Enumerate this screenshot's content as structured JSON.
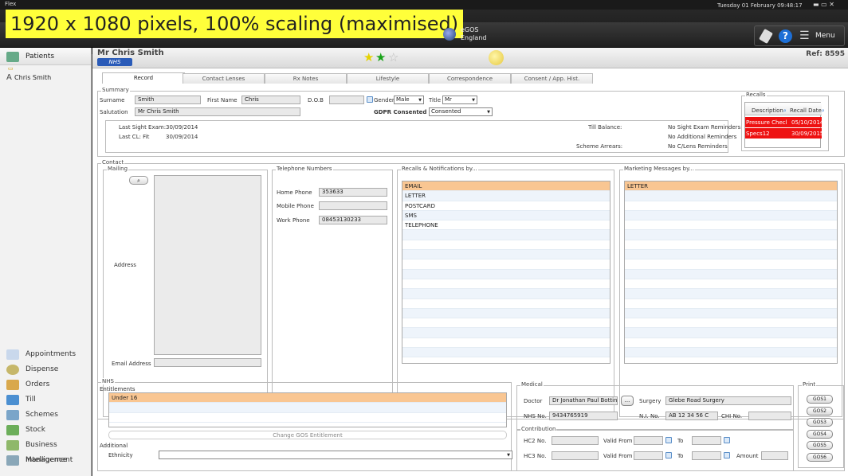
{
  "window": {
    "title": "Flex",
    "datetime": "Tuesday 01 February 09:48:17"
  },
  "banner": "1920 x 1080 pixels, 100% scaling (maximised)",
  "egos": {
    "line1": "eGOS",
    "line2": "England"
  },
  "toolbar": {
    "menu_label": "Menu"
  },
  "leftnav": {
    "header": "Patients",
    "patient": "Chris Smith",
    "items": [
      "Appointments",
      "Dispense",
      "Orders",
      "Till",
      "Schemes",
      "Stock",
      "Business Intelligence",
      "Management"
    ]
  },
  "patient": {
    "name": "Mr Chris Smith",
    "badge": "NHS",
    "ref": "Ref: 8595"
  },
  "tabs": [
    "Record",
    "Contact Lenses",
    "Rx Notes",
    "Lifestyle",
    "Correspondence",
    "Consent / App. Hist."
  ],
  "summary": {
    "legend": "Summary",
    "surname_label": "Surname",
    "surname": "Smith",
    "firstname_label": "First Name",
    "firstname": "Chris",
    "dob_label": "D.O.B",
    "gender_label": "Gender",
    "gender": "Male",
    "title_label": "Title",
    "title": "Mr",
    "salutation_label": "Salutation",
    "salutation": "Mr Chris Smith",
    "gdpr_label": "GDPR Consented",
    "gdpr": "Consented",
    "last_sight_label": "Last Sight Exam:",
    "last_sight": "30/09/2014",
    "last_cl_label": "Last CL: Fit",
    "last_cl": "30/09/2014",
    "till_label": "Till Balance:",
    "scheme_label": "Scheme Arrears:",
    "reminders": [
      "No Sight Exam Reminders",
      "No Additional Reminders",
      "No C/Lens Reminders"
    ]
  },
  "recalls": {
    "legend": "Recalls",
    "col1": "Description",
    "col2": "Recall Date",
    "rows": [
      {
        "desc": "Pressure Checl",
        "date": "05/10/2014"
      },
      {
        "desc": "Specs12",
        "date": "30/09/2015"
      }
    ]
  },
  "contact": {
    "legend": "Contact",
    "mailing_legend": "Mailing",
    "address_label": "Address",
    "email_label": "Email Address",
    "tel_legend": "Telephone Numbers",
    "home_label": "Home Phone",
    "home": "353633",
    "mobile_label": "Mobile Phone",
    "mobile": "",
    "work_label": "Work Phone",
    "work": "08453130233",
    "recall_legend": "Recalls & Notifications by...",
    "recall_items": [
      "EMAIL",
      "LETTER",
      "POSTCARD",
      "SMS",
      "TELEPHONE"
    ],
    "marketing_legend": "Marketing Messages by...",
    "marketing_items": [
      "LETTER"
    ]
  },
  "nhs": {
    "legend": "NHS",
    "entitlements_legend": "Entitlements",
    "entitlement": "Under 16",
    "change_button": "Change GOS Entitlement",
    "additional_legend": "Additional",
    "ethnicity_label": "Ethnicity"
  },
  "medical": {
    "legend": "Medical",
    "doctor_label": "Doctor",
    "doctor": "Dr Jonathan Paul Botting",
    "surgery_label": "Surgery",
    "surgery": "Glebe Road Surgery",
    "nhsno_label": "NHS No.",
    "nhsno": "9434765919",
    "ni_label": "N.I. No.",
    "ni": "AB 12 34 56 C",
    "chi_label": "CHI No."
  },
  "contribution": {
    "legend": "Contribution",
    "hc2_label": "HC2 No.",
    "hc3_label": "HC3 No.",
    "valid_from": "Valid From",
    "to": "To",
    "amount": "Amount"
  },
  "print": {
    "legend": "Print",
    "buttons": [
      "GOS1",
      "GOS2",
      "GOS3",
      "GOS4",
      "GOS5",
      "GOS6"
    ]
  }
}
